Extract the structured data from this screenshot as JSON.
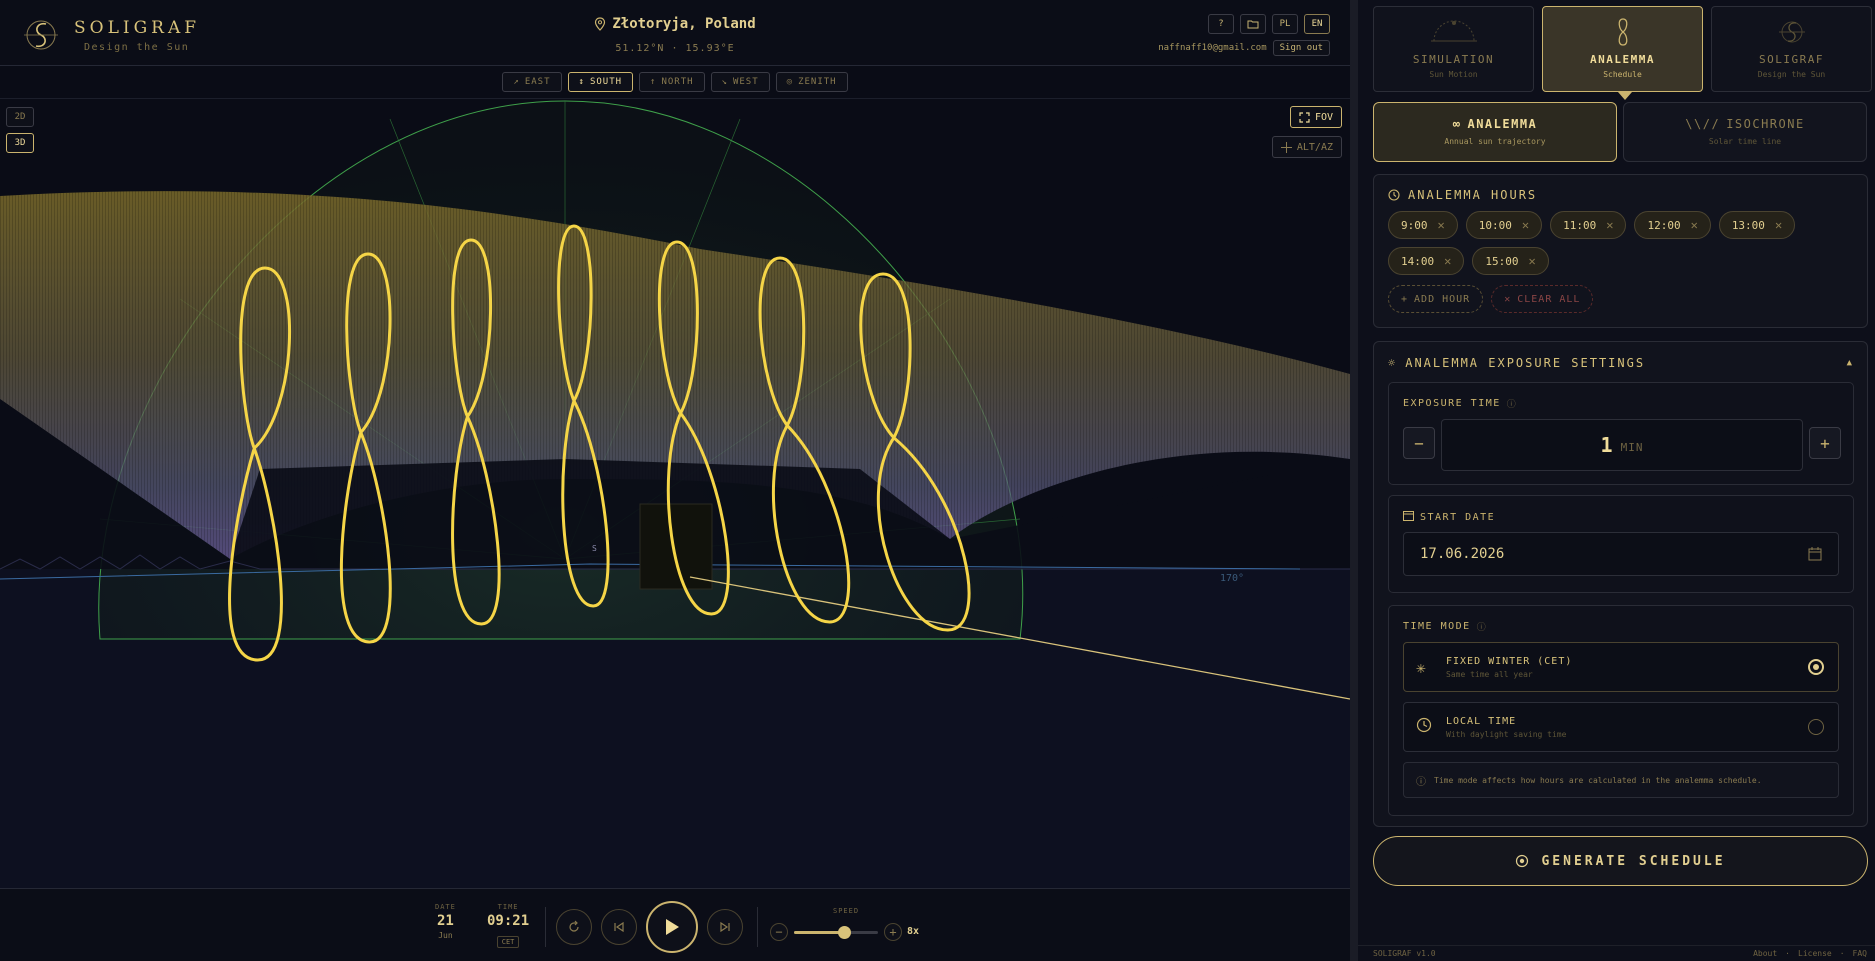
{
  "app": {
    "name": "SOLIGRAF",
    "tagline": "Design the Sun"
  },
  "location": {
    "name": "Złotoryja, Poland",
    "coords": "51.12°N · 15.93°E"
  },
  "topbar": {
    "help": "?",
    "lang_pl": "PL",
    "lang_en": "EN",
    "email": "naffnaff10@gmail.com",
    "sign_out": "Sign out"
  },
  "directions": [
    {
      "label": "EAST",
      "glyph": "↗"
    },
    {
      "label": "SOUTH",
      "glyph": "↕"
    },
    {
      "label": "NORTH",
      "glyph": "↑"
    },
    {
      "label": "WEST",
      "glyph": "↘"
    },
    {
      "label": "ZENITH",
      "glyph": "◎"
    }
  ],
  "active_direction": "SOUTH",
  "view_modes": {
    "two_d": "2D",
    "three_d": "3D"
  },
  "view_tools": {
    "fov": "FOV",
    "altaz": "ALT/AZ"
  },
  "scene_labels": {
    "s_marker": "S",
    "azimuth": "170°"
  },
  "playback": {
    "date_label": "DATE",
    "date_day": "21",
    "date_month": "Jun",
    "time_label": "TIME",
    "time_value": "09:21",
    "time_zone": "CET",
    "speed_label": "SPEED",
    "speed_value": "8x",
    "speed_level": 0.6
  },
  "tabs": [
    {
      "title": "SIMULATION",
      "sub": "Sun Motion"
    },
    {
      "title": "ANALEMMA",
      "sub": "Schedule"
    },
    {
      "title": "SOLIGRAF",
      "sub": "Design the Sun"
    }
  ],
  "subtabs": [
    {
      "title": "ANALEMMA",
      "sub": "Annual sun trajectory"
    },
    {
      "title": "ISOCHRONE",
      "sub": "Solar time line"
    }
  ],
  "hours_card": {
    "title": "ANALEMMA HOURS",
    "hours": [
      "9:00",
      "10:00",
      "11:00",
      "12:00",
      "13:00",
      "14:00",
      "15:00"
    ],
    "add": "ADD HOUR",
    "clear": "CLEAR ALL"
  },
  "exposure_card": {
    "title": "ANALEMMA EXPOSURE SETTINGS",
    "exposure_label": "EXPOSURE TIME",
    "exposure_value": "1",
    "exposure_unit": "MIN",
    "start_label": "START DATE",
    "start_value": "17.06.2026",
    "time_mode_label": "TIME MODE",
    "modes": [
      {
        "title": "FIXED WINTER (CET)",
        "sub": "Same time all year"
      },
      {
        "title": "LOCAL TIME",
        "sub": "With daylight saving time"
      }
    ],
    "note": "Time mode affects how hours are calculated in the analemma schedule."
  },
  "generate": "GENERATE SCHEDULE",
  "footer": {
    "version": "SOLIGRAF v1.0",
    "about": "About",
    "license": "License",
    "faq": "FAQ"
  },
  "colors": {
    "accent": "#cbb46e",
    "gold": "#f5d547",
    "dome": "#2f8a3a",
    "bg": "#0a0c16"
  }
}
